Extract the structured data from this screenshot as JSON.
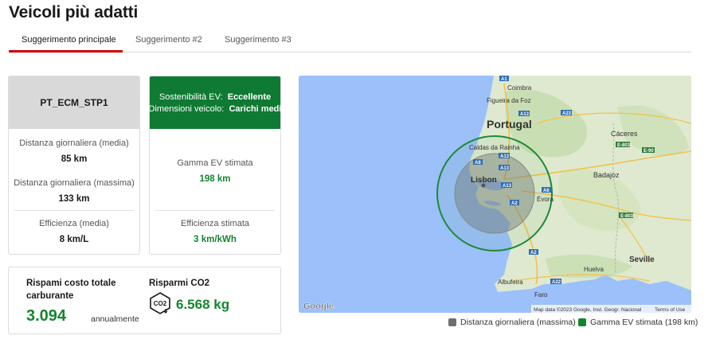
{
  "page": {
    "title": "Veicoli più adatti"
  },
  "tabs": [
    {
      "label": "Suggerimento principale",
      "active": true
    },
    {
      "label": "Suggerimento #2",
      "active": false
    },
    {
      "label": "Suggerimento #3",
      "active": false
    }
  ],
  "current_vehicle": {
    "name": "PT_ECM_STP1",
    "daily_avg_label": "Distanza giornaliera (media)",
    "daily_avg_value": "85 km",
    "daily_max_label": "Distanza giornaliera (massima)",
    "daily_max_value": "133 km",
    "efficiency_label": "Efficienza (media)",
    "efficiency_value": "8 km/L"
  },
  "ev_suggestion": {
    "sustainability_label": "Sostenibilità EV:",
    "sustainability_value": "Eccellente",
    "size_label": "Dimensioni veicolo:",
    "size_value": "Carichi medi",
    "range_label": "Gamma EV stimata",
    "range_value": "198 km",
    "efficiency_label": "Efficienza stimata",
    "efficiency_value": "3 km/kWh",
    "header_color": "#0e7a33"
  },
  "savings": {
    "fuel_label": "Rispami costo totale carburante",
    "fuel_value": "3.094",
    "fuel_period": "annualmente",
    "co2_label": "Risparmi CO2",
    "co2_icon_text": "CO2",
    "co2_value": "6.568 kg"
  },
  "map": {
    "labels": {
      "country": "Portugal",
      "coimbra": "Coimbra",
      "figueira": "Figueira\nda Foz",
      "caldas": "Caldas da\nRainha",
      "lisbon": "Lisbon",
      "caceres": "Cáceres",
      "badajoz": "Badajoz",
      "evora": "Évora",
      "seville": "Seville",
      "huelva": "Huelva",
      "faro": "Faro",
      "albufeira": "Albufeira"
    },
    "road_shields": [
      "A1",
      "A13",
      "A23",
      "A8",
      "A13",
      "A13",
      "A13",
      "A2",
      "A2",
      "A6",
      "E-803",
      "E-90",
      "E-803",
      "A22"
    ],
    "attribution": "Map data ©2023 Google, Inst. Geogr. Nacional",
    "terms": "Terms of Use",
    "google": "Google",
    "range_circle_color": "#1c8a38",
    "max_distance_circle_color": "#7a7a7a"
  },
  "legend": {
    "max_distance": "Distanza giornaliera (massima)",
    "ev_range": "Gamma EV stimata (198 km)",
    "max_distance_color": "#6f6f6f",
    "ev_range_color": "#14852e"
  }
}
